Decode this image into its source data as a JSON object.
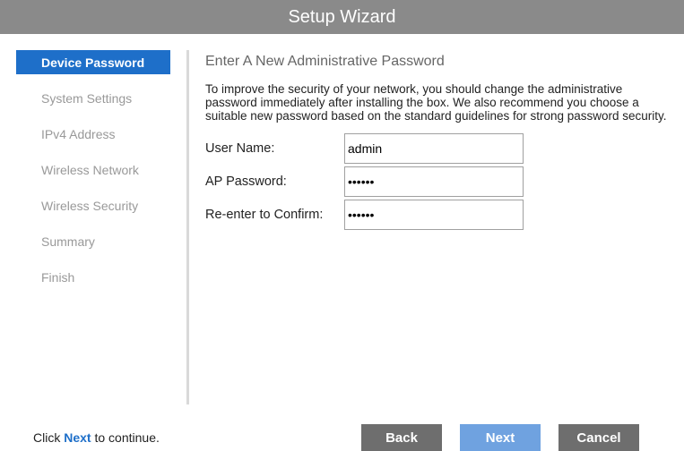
{
  "window": {
    "title": "Setup Wizard"
  },
  "sidebar": {
    "items": [
      {
        "label": "Device Password",
        "active": true
      },
      {
        "label": "System Settings",
        "active": false
      },
      {
        "label": "IPv4 Address",
        "active": false
      },
      {
        "label": "Wireless Network",
        "active": false
      },
      {
        "label": "Wireless Security",
        "active": false
      },
      {
        "label": "Summary",
        "active": false
      },
      {
        "label": "Finish",
        "active": false
      }
    ]
  },
  "main": {
    "heading": "Enter A New Administrative Password",
    "description": "To improve the security of your network, you should change the administrative password immediately after installing the box. We also recommend you choose a suitable new password based on the standard guidelines for strong password security.",
    "fields": {
      "username": {
        "label": "User Name:",
        "value": "admin"
      },
      "password": {
        "label": "AP Password:",
        "value": "••••••"
      },
      "confirm": {
        "label": "Re-enter to Confirm:",
        "value": "••••••"
      }
    }
  },
  "footer": {
    "hint_prefix": "Click ",
    "hint_link": "Next",
    "hint_suffix": " to continue.",
    "back_label": "Back",
    "next_label": "Next",
    "cancel_label": "Cancel"
  },
  "colors": {
    "accent": "#1e6fc9",
    "titlebar": "#8a8a8a",
    "button_dark": "#6e6e6e",
    "button_next": "#6fa2e0"
  }
}
